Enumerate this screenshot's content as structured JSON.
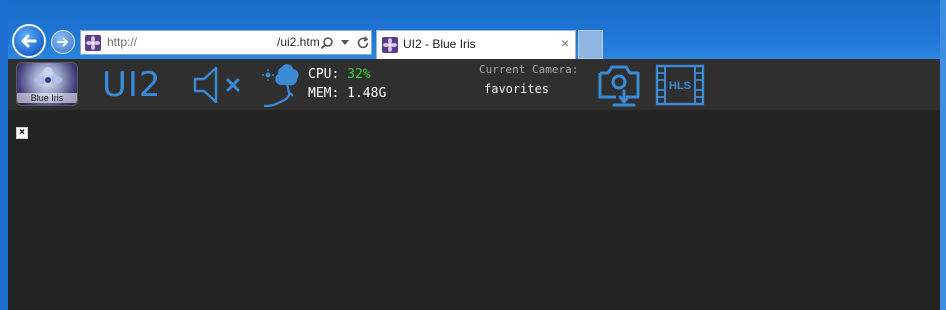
{
  "browser": {
    "address": {
      "prefix": "http://",
      "suffix": "/ui2.htm"
    },
    "tab": {
      "title": "UI2 - Blue Iris",
      "close": "×"
    }
  },
  "toolbar": {
    "logo_label": "Blue Iris",
    "title": "UI2",
    "cpu_label": "CPU:",
    "cpu_value": "32%",
    "mem_label": "MEM:",
    "mem_value": "1.48G",
    "current_camera_label": "Current Camera:",
    "current_camera_value": "favorites",
    "hls_label": "HLS"
  },
  "content": {
    "broken_image_glyph": "×"
  },
  "colors": {
    "accent": "#3a8ad6",
    "cpu_ok": "#37d631",
    "toolbar_bg": "#2f2f2f",
    "content_bg": "#232323"
  },
  "icons": [
    "back-arrow-icon",
    "forward-arrow-icon",
    "search-icon",
    "dropdown-icon",
    "refresh-icon",
    "site-favicon",
    "speaker-muted-icon",
    "cloud-weather-icon",
    "camera-download-icon",
    "hls-film-icon",
    "broken-image-icon"
  ]
}
